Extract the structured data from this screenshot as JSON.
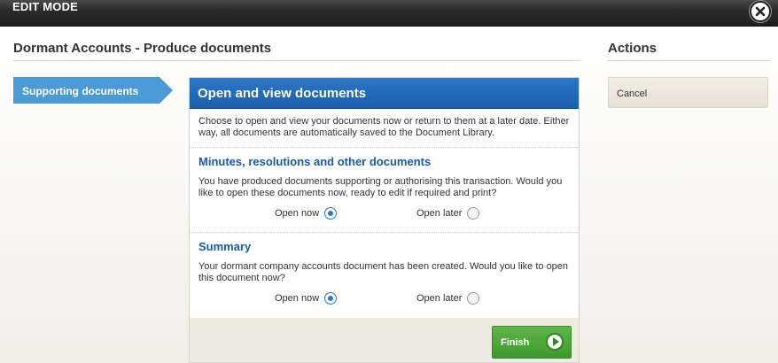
{
  "topbar": {
    "mode_label": "EDIT MODE",
    "close_icon": "close-icon"
  },
  "page": {
    "title": "Dormant Accounts - Produce documents"
  },
  "sidebar": {
    "step_label": "Supporting documents"
  },
  "actions": {
    "title": "Actions",
    "cancel_label": "Cancel"
  },
  "panel": {
    "header": "Open and view documents",
    "intro": "Choose to open and view your documents now or return to them at a later date. Either way, all documents are automatically saved to the Document Library.",
    "sections": [
      {
        "title": "Minutes, resolutions and other documents",
        "text": "You have produced documents supporting or authorising this transaction. Would you like to open these documents now, ready to edit if required and print?",
        "option_now": "Open now",
        "option_later": "Open later",
        "selected": "Open now"
      },
      {
        "title": "Summary",
        "text": "Your dormant company accounts document has been created. Would you like to open this document now?",
        "option_now": "Open now",
        "option_later": "Open later",
        "selected": "Open now"
      }
    ],
    "finish_label": "Finish"
  },
  "colors": {
    "accent_blue": "#1b5fae",
    "tab_blue": "#4a9ad6",
    "finish_green": "#3e9a2d"
  }
}
